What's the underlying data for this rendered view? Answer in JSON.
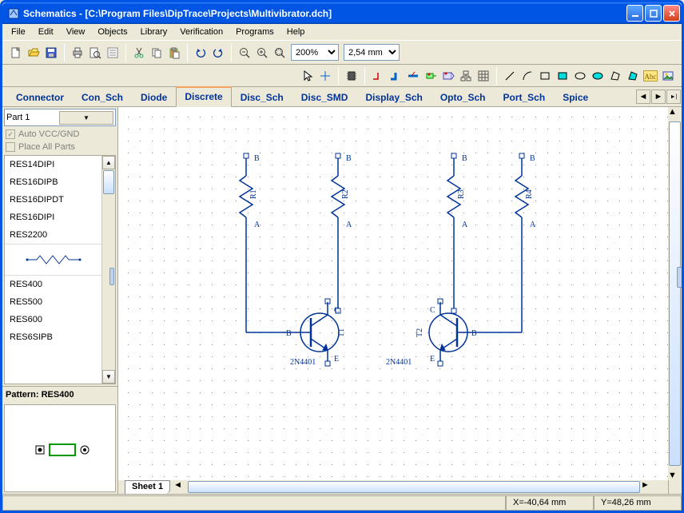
{
  "window": {
    "title": "Schematics - [C:\\Program Files\\DipTrace\\Projects\\Multivibrator.dch]"
  },
  "menu": [
    "File",
    "Edit",
    "View",
    "Objects",
    "Library",
    "Verification",
    "Programs",
    "Help"
  ],
  "zoom": {
    "value": "200%",
    "grid": "2,54 mm"
  },
  "tabs": {
    "items": [
      "Connector",
      "Con_Sch",
      "Diode",
      "Discrete",
      "Disc_Sch",
      "Disc_SMD",
      "Display_Sch",
      "Opto_Sch",
      "Port_Sch",
      "Spice"
    ],
    "active": "Discrete"
  },
  "sidebar": {
    "part_selector": "Part 1",
    "auto_vcc": "Auto VCC/GND",
    "place_all": "Place All Parts",
    "parts": [
      "RES14DIPI",
      "RES16DIPB",
      "RES16DIPDT",
      "RES16DIPI",
      "RES2200",
      "",
      "RES400",
      "RES500",
      "RES600",
      "RES6SIPB"
    ],
    "pattern_label": "Pattern: RES400"
  },
  "schematic": {
    "resistors": [
      {
        "name": "R1",
        "a": "A",
        "b": "B"
      },
      {
        "name": "R2",
        "a": "A",
        "b": "B"
      },
      {
        "name": "R3",
        "a": "A",
        "b": "B"
      },
      {
        "name": "R4",
        "a": "A",
        "b": "B"
      }
    ],
    "transistors": [
      {
        "name": "T1",
        "part": "2N4401",
        "b": "B",
        "c": "C",
        "e": "E"
      },
      {
        "name": "T2",
        "part": "2N4401",
        "b": "B",
        "c": "C",
        "e": "E"
      }
    ]
  },
  "sheet": "Sheet 1",
  "status": {
    "x": "X=-40,64 mm",
    "y": "Y=48,26 mm"
  }
}
